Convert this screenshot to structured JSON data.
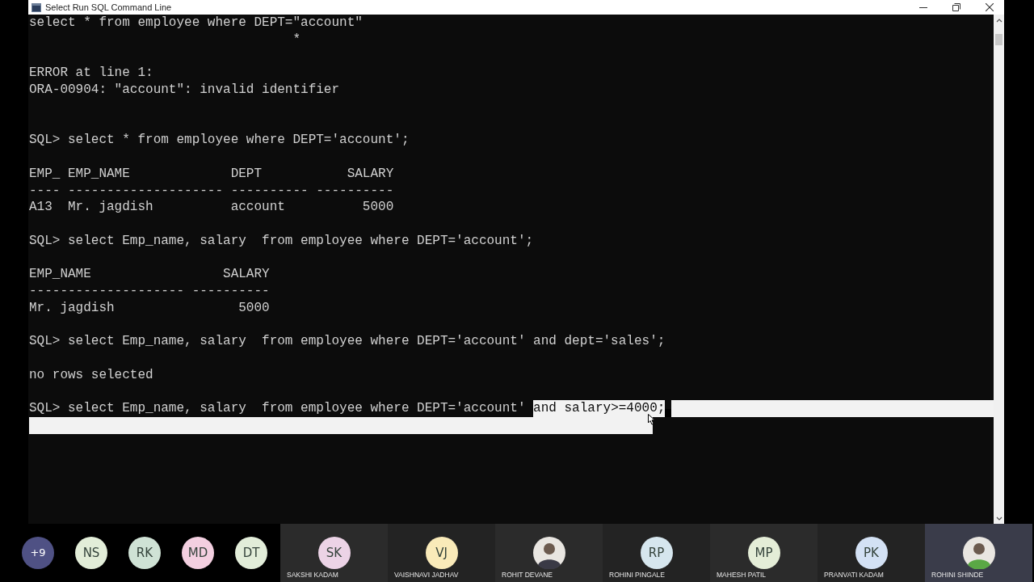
{
  "window": {
    "title": "Select Run SQL Command Line"
  },
  "console": {
    "lines": [
      {
        "kind": "text",
        "text": "select * from employee where DEPT=\"account\""
      },
      {
        "kind": "text",
        "text": "                                  *"
      },
      {
        "kind": "blank"
      },
      {
        "kind": "text",
        "text": "ERROR at line 1:"
      },
      {
        "kind": "text",
        "text": "ORA-00904: \"account\": invalid identifier"
      },
      {
        "kind": "blank"
      },
      {
        "kind": "blank"
      },
      {
        "kind": "text",
        "text": "SQL> select * from employee where DEPT='account';"
      },
      {
        "kind": "blank"
      },
      {
        "kind": "text",
        "text": "EMP_ EMP_NAME             DEPT           SALARY"
      },
      {
        "kind": "text",
        "text": "---- -------------------- ---------- ----------"
      },
      {
        "kind": "text",
        "text": "A13  Mr. jagdish          account          5000"
      },
      {
        "kind": "blank"
      },
      {
        "kind": "text",
        "text": "SQL> select Emp_name, salary  from employee where DEPT='account';"
      },
      {
        "kind": "blank"
      },
      {
        "kind": "text",
        "text": "EMP_NAME                 SALARY"
      },
      {
        "kind": "text",
        "text": "-------------------- ----------"
      },
      {
        "kind": "text",
        "text": "Mr. jagdish                5000"
      },
      {
        "kind": "blank"
      },
      {
        "kind": "text",
        "text": "SQL> select Emp_name, salary  from employee where DEPT='account' and dept='sales';"
      },
      {
        "kind": "blank"
      },
      {
        "kind": "text",
        "text": "no rows selected"
      },
      {
        "kind": "blank"
      },
      {
        "kind": "segments",
        "segments": [
          {
            "text": "SQL> select Emp_name, salary  from employee where DEPT='account' ",
            "selected": false
          },
          {
            "text": "and salary>=4000;",
            "selected": true
          }
        ]
      },
      {
        "kind": "selection-tail"
      }
    ]
  },
  "participants_overflow": {
    "label": "+9",
    "color": "#4f5184"
  },
  "participant_bubbles": [
    {
      "initials": "NS",
      "color": "#e2edd8"
    },
    {
      "initials": "RK",
      "color": "#cfe2d5"
    },
    {
      "initials": "MD",
      "color": "#f3cfe0"
    },
    {
      "initials": "DT",
      "color": "#e2edd9"
    }
  ],
  "participant_tiles": [
    {
      "kind": "initials",
      "initials": "SK",
      "name": "SAKSHI KADAM",
      "color": "#ecd3e6",
      "speaking": false
    },
    {
      "kind": "initials",
      "initials": "VJ",
      "name": "VAISHNAVI JADHAV",
      "color": "#f9eab9",
      "speaking": false
    },
    {
      "kind": "photo",
      "name": "ROHIT DEVANE",
      "speaking": false
    },
    {
      "kind": "initials",
      "initials": "RP",
      "name": "ROHINI PINGALE",
      "color": "#d6e6ee",
      "speaking": false
    },
    {
      "kind": "initials",
      "initials": "MP",
      "name": "MAHESH PATIL",
      "color": "#e4edd7",
      "speaking": false
    },
    {
      "kind": "initials",
      "initials": "PK",
      "name": "PRANVATI KADAM",
      "color": "#d3e1f4",
      "speaking": false
    },
    {
      "kind": "photo",
      "name": "ROHINI SHINDE",
      "speaking": true
    }
  ]
}
